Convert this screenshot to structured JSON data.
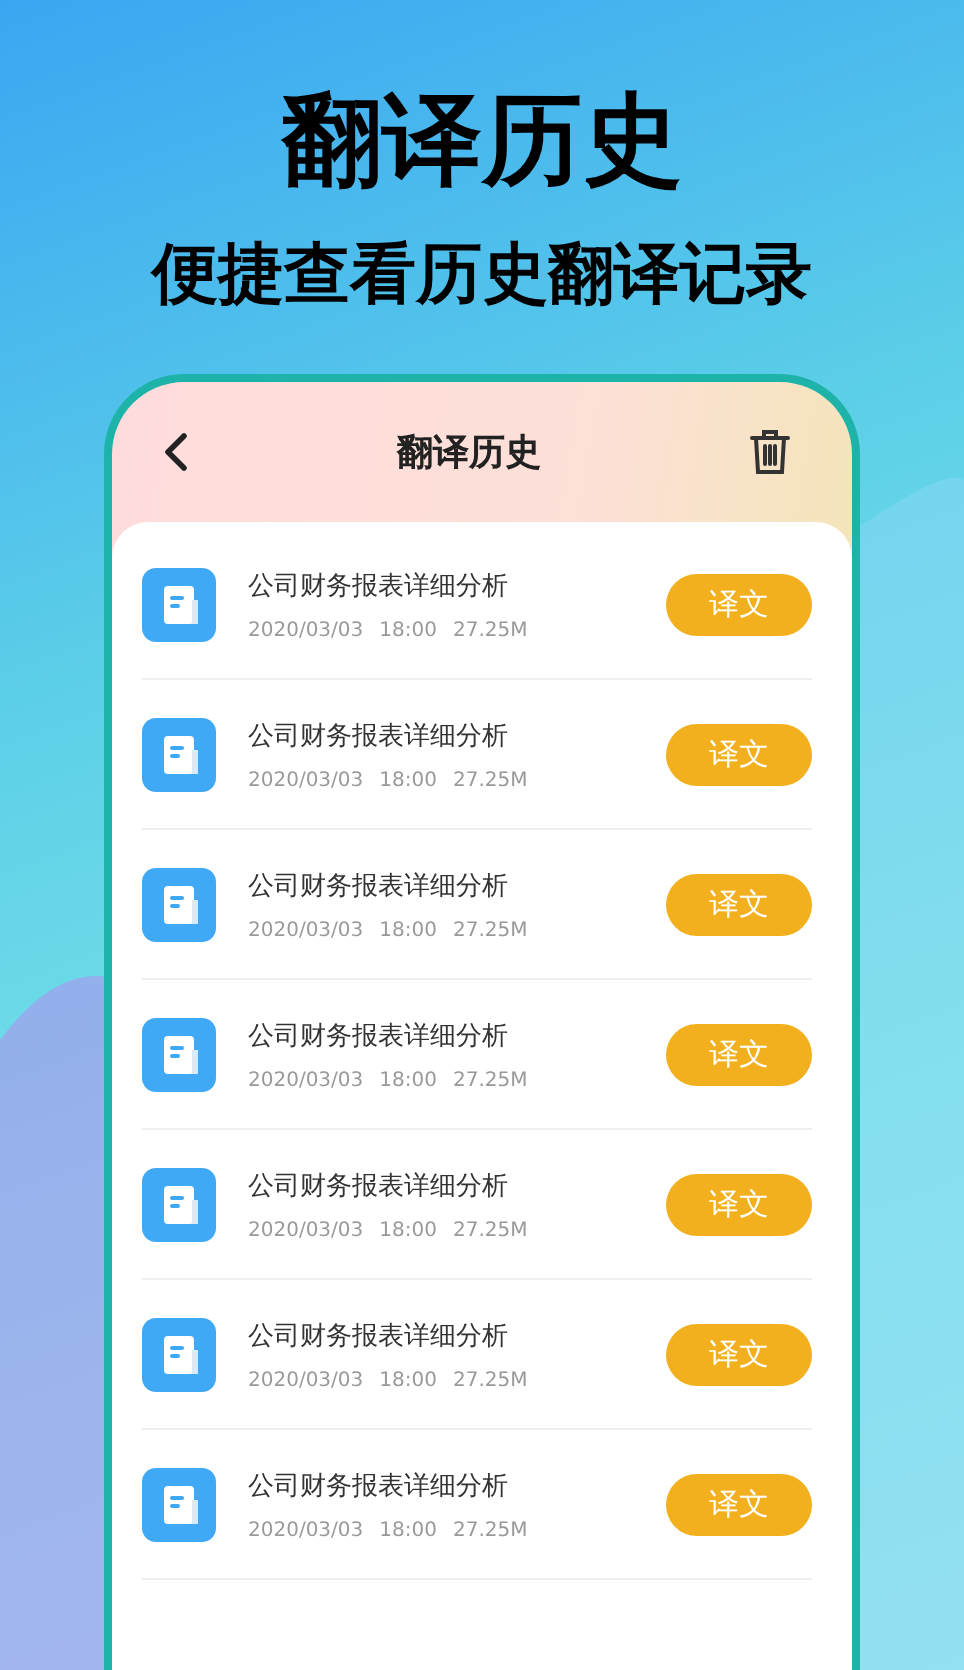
{
  "headline": "翻译历史",
  "subheadline": "便捷查看历史翻译记录",
  "screen": {
    "title": "翻译历史",
    "records": [
      {
        "name": "公司财务报表详细分析",
        "date": "2020/03/03",
        "time": "18:00",
        "size": "27.25M",
        "action": "译文"
      },
      {
        "name": "公司财务报表详细分析",
        "date": "2020/03/03",
        "time": "18:00",
        "size": "27.25M",
        "action": "译文"
      },
      {
        "name": "公司财务报表详细分析",
        "date": "2020/03/03",
        "time": "18:00",
        "size": "27.25M",
        "action": "译文"
      },
      {
        "name": "公司财务报表详细分析",
        "date": "2020/03/03",
        "time": "18:00",
        "size": "27.25M",
        "action": "译文"
      },
      {
        "name": "公司财务报表详细分析",
        "date": "2020/03/03",
        "time": "18:00",
        "size": "27.25M",
        "action": "译文"
      },
      {
        "name": "公司财务报表详细分析",
        "date": "2020/03/03",
        "time": "18:00",
        "size": "27.25M",
        "action": "译文"
      },
      {
        "name": "公司财务报表详细分析",
        "date": "2020/03/03",
        "time": "18:00",
        "size": "27.25M",
        "action": "译文"
      }
    ]
  }
}
